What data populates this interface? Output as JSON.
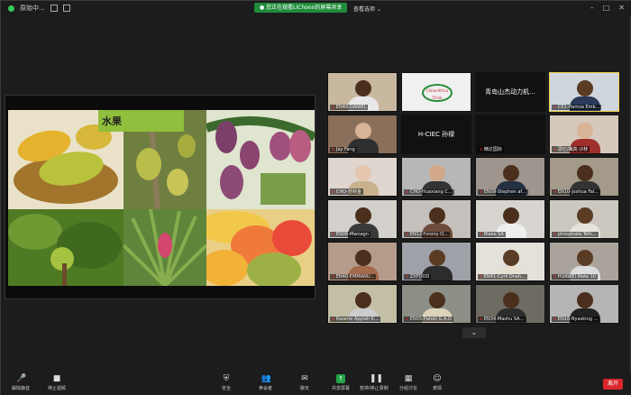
{
  "topbar": {
    "app_label": "原始中...",
    "share_banner": "● 您正在观看LIChoon的屏幕共享",
    "view_options": "查看选项 ⌄",
    "window_controls": [
      "–",
      "□",
      "✕"
    ]
  },
  "slide": {
    "title": "水果"
  },
  "gallery": {
    "tiles": [
      {
        "name": "EN40-DANIEL",
        "bg": "#c9b8a0",
        "skin": "#4a2f1d",
        "shirt": "#e8e8e8"
      },
      {
        "name": "",
        "bg": "#f0f0f0",
        "skin": "",
        "shirt": "",
        "logo_text": "China-Africa Think"
      },
      {
        "name": "",
        "bg": "#111",
        "skin": "",
        "shirt": "",
        "center_text": "青岛山杰动力机..."
      },
      {
        "name": "CE1-Hamza Emb...",
        "bg": "#cfd6dd",
        "skin": "#5a3b24",
        "shirt": "#2c3a5a",
        "active": true
      },
      {
        "name": "Jay Fang",
        "bg": "#8a6f5a",
        "skin": "#d8b396",
        "shirt": "#2f2f2f"
      },
      {
        "name": "",
        "bg": "#111",
        "skin": "",
        "shirt": "",
        "center_text": "H-CIEC 孙禄"
      },
      {
        "name": "精达国际",
        "bg": "#111",
        "skin": "",
        "shirt": ""
      },
      {
        "name": "思忆/鹰真·沙林",
        "bg": "#d5c8bd",
        "skin": "#d8b396",
        "shirt": "#a0302c"
      },
      {
        "name": "CHO-舒莉金",
        "bg": "#e0d6d0",
        "skin": "#e4c6ae",
        "shirt": "#c8b28e"
      },
      {
        "name": "CHO-Huaxiang C...",
        "bg": "#b7b7b7",
        "skin": "#d2a889",
        "shirt": "#333"
      },
      {
        "name": "EN09-Stephen af...",
        "bg": "#9e958e",
        "skin": "#4a2f1d",
        "shirt": "#243042"
      },
      {
        "name": "EN10-Joshua Fal...",
        "bg": "#a39a8a",
        "skin": "#4a2f1d",
        "shirt": "#333"
      },
      {
        "name": "EN06-Mwnagn",
        "bg": "#d4d0cc",
        "skin": "#4a2f1d",
        "shirt": "#3a3a3a"
      },
      {
        "name": "EN12-Yvrony O...",
        "bg": "#c5c0bb",
        "skin": "#4a2f1d",
        "shirt": "#6e4c3c"
      },
      {
        "name": "Blake SA",
        "bg": "#d8d5d0",
        "skin": "#4a2f1d",
        "shirt": "#eee"
      },
      {
        "name": "phosphate Tefn...",
        "bg": "#ccc8c0",
        "skin": "#5a3b24",
        "shirt": "#e7e3dc"
      },
      {
        "name": "EN40-EMMANU...",
        "bg": "#b59b8a",
        "skin": "#4a2f1d",
        "shirt": "#a36a4c"
      },
      {
        "name": "ZXFOOD",
        "bg": "#9fa1a8",
        "skin": "#5a3b24",
        "shirt": "#2c2c2c"
      },
      {
        "name": "EN41-Cyril Onah...",
        "bg": "#e4e0da",
        "skin": "#5a3b24",
        "shirt": "#e6dfd2"
      },
      {
        "name": "HUAWEI Mate 10",
        "bg": "#aaa39b",
        "skin": "#5a3b24",
        "shirt": "#dcdcdc"
      },
      {
        "name": "Kwame Appiah K...",
        "bg": "#c3bfa5",
        "skin": "#4a2f1d",
        "shirt": "#ccc"
      },
      {
        "name": "EN05-Patoki G.A.O",
        "bg": "#8b8f86",
        "skin": "#4a2f1d",
        "shirt": "#dcd3bb"
      },
      {
        "name": "EN34-Mashu SA...",
        "bg": "#6e6b63",
        "skin": "#4a2f1d",
        "shirt": "#2d2d2d"
      },
      {
        "name": "EN16-Nyasking ...",
        "bg": "#b5b5b5",
        "skin": "#4a2f1d",
        "shirt": "#222"
      }
    ]
  },
  "toolbar": {
    "buttons": [
      {
        "label": "解除静音",
        "icon": "🎤"
      },
      {
        "label": "停止视频",
        "icon": "■"
      },
      {
        "label": "安全",
        "icon": "⛨"
      },
      {
        "label": "参会者",
        "icon": "👥"
      },
      {
        "label": "聊天",
        "icon": "✉"
      },
      {
        "label": "共享屏幕",
        "icon": "↑"
      },
      {
        "label": "暂停/停止录制",
        "icon": "❚❚"
      },
      {
        "label": "分组讨论",
        "icon": "▦"
      },
      {
        "label": "表情",
        "icon": "☺"
      }
    ],
    "end_label": "离开"
  },
  "chev": "⌄"
}
